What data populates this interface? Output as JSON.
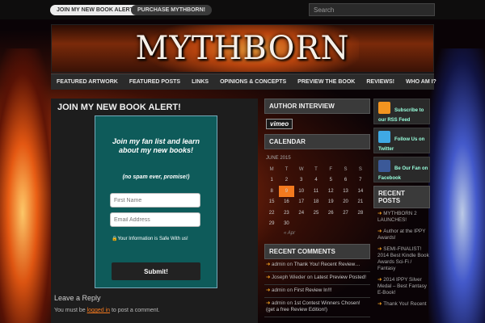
{
  "topbar": {
    "tabs": [
      "JOIN MY NEW BOOK ALERT!",
      "PURCHASE MYTHBORN!"
    ],
    "search_placeholder": "Search"
  },
  "header": {
    "logo": "MYTHBORN"
  },
  "nav": [
    "FEATURED ARTWORK",
    "FEATURED POSTS",
    "LINKS",
    "OPINIONS & CONCEPTS",
    "PREVIEW THE BOOK",
    "REVIEWS!",
    "WHO AM I?"
  ],
  "main": {
    "title": "JOIN MY NEW BOOK ALERT!",
    "signup_heading": "Join my fan list and learn about my new books!",
    "signup_sub": "(no spam ever, promise!)",
    "first_name_placeholder": "First Name",
    "email_placeholder": "Email Address",
    "safe_text": "Your Information is Safe With us!",
    "submit": "Submit!",
    "leave_reply": "Leave a Reply",
    "must_be_prefix": "You must be ",
    "login_link": "logged in",
    "must_be_suffix": " to post a comment."
  },
  "middle": {
    "author_interview_title": "AUTHOR INTERVIEW",
    "vimeo_label": "vimeo",
    "calendar_title": "CALENDAR",
    "month": "JUNE 2015",
    "weekdays": [
      "M",
      "T",
      "W",
      "T",
      "F",
      "S",
      "S"
    ],
    "weeks": [
      [
        "1",
        "2",
        "3",
        "4",
        "5",
        "6",
        "7"
      ],
      [
        "8",
        "9",
        "10",
        "11",
        "12",
        "13",
        "14"
      ],
      [
        "15",
        "16",
        "17",
        "18",
        "19",
        "20",
        "21"
      ],
      [
        "22",
        "23",
        "24",
        "25",
        "26",
        "27",
        "28"
      ],
      [
        "29",
        "30",
        "",
        "",
        "",
        "",
        ""
      ]
    ],
    "today": "9",
    "prev": "« Apr",
    "recent_comments_title": "RECENT COMMENTS",
    "recent_comments": [
      {
        "author": "admin",
        "on": " on ",
        "post": "Thank You! Recent Review…"
      },
      {
        "author": "Joseph Wieder",
        "on": " on ",
        "post": "Latest Preview Posted!"
      },
      {
        "author": "admin",
        "on": " on ",
        "post": "First Review In!!!"
      },
      {
        "author": "admin",
        "on": " on ",
        "post": "1st Contest Winners Chosen! (get a free Review Edition!)"
      }
    ]
  },
  "right": {
    "rss": "Subscribe to our RSS Feed",
    "twitter": "Follow Us on Twitter",
    "facebook": "Be Our Fan on Facebook",
    "recent_posts_title": "RECENT POSTS",
    "recent_posts": [
      "MYTHBORN 2 LAUNCHES!",
      "Author at the IPPY Awards!",
      "SEMI-FINALIST! 2014 Best Kindle Book Awards Sci-Fi / Fantasy",
      "2014 IPPY Silver Medal – Best Fantasy E-Book!",
      "Thank You! Recent"
    ]
  }
}
